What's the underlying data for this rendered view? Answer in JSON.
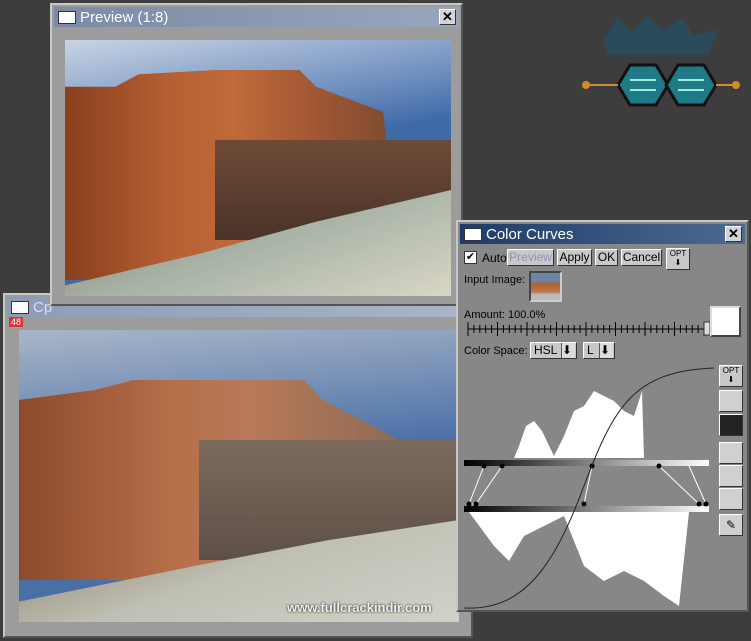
{
  "logo": {
    "name": "fullcrackindir logo"
  },
  "preview_window": {
    "title": "Preview (1:8)",
    "close": "✕"
  },
  "back_window": {
    "title": "Cp",
    "badge": "48",
    "close": "✕"
  },
  "watermark": "www.fullcrackindir.com",
  "color_curves": {
    "title": "Color Curves",
    "close": "✕",
    "auto_label": "Auto",
    "auto_checked": true,
    "buttons": {
      "preview": "Preview",
      "apply": "Apply",
      "ok": "OK",
      "cancel": "Cancel",
      "opt": "OPT"
    },
    "input_image_label": "Input Image:",
    "amount_label": "Amount: 100.0%",
    "amount_percent": 100,
    "color_space_label": "Color Space:",
    "color_space": "HSL",
    "channel": "L",
    "side_opt": "OPT",
    "side_icons": [
      "curve-smooth-icon",
      "histogram-toggle-icon",
      "step-curve-icon",
      "curve-convex-icon",
      "curve-linear-icon",
      "eyedropper-icon"
    ]
  }
}
